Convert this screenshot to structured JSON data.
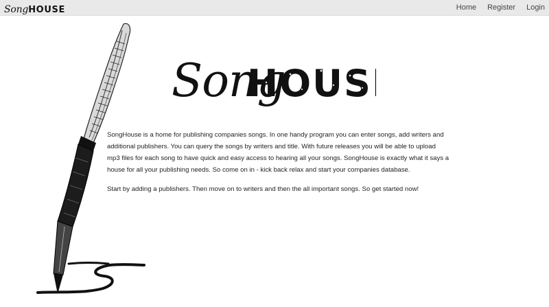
{
  "navbar": {
    "brand_song": "Song",
    "brand_house": "HOUSE",
    "links": [
      "Home",
      "Register",
      "Login"
    ]
  },
  "logo": {
    "song": "Song",
    "house": "HOUSE"
  },
  "content": {
    "intro": "SongHouse is a home for publishing companies songs. In one handy program you can enter songs, add writers and additional publishers. You can query the songs by writers and title. With future releases you will be able to upload mp3 files for each song to have quick and easy access to hearing all your songs. SongHouse is exactly what it says a house for all your publishing needs. So come on in - kick back relax and start your companies database.",
    "cta": "Start by adding a publishers. Then move on to writers and then the all important songs. So get started now!"
  },
  "icons": {
    "pen": "fountain-pen-icon"
  }
}
